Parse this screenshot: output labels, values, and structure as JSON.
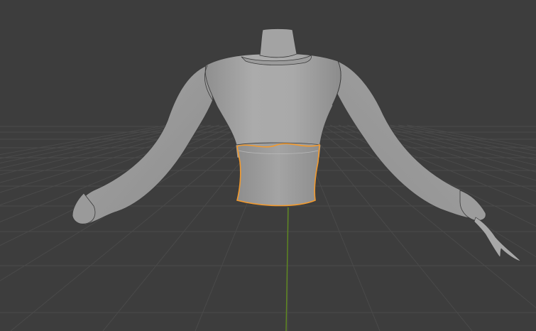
{
  "viewport": {
    "background_color": "#3d3d3d",
    "grid_line_color": "#4a4a4a",
    "y_axis_color": "#5f8a1f",
    "selection_outline_color": "#f29a2e",
    "mesh_color": "#a6a6a6",
    "mesh_shadow_color": "#8a8a8a",
    "mesh_highlight_color": "#b8b8b8",
    "mesh_edge_color": "#3a3a3a"
  },
  "scene": {
    "object": "sweater-mesh",
    "selected_part": "waistband",
    "shading": "solid"
  }
}
